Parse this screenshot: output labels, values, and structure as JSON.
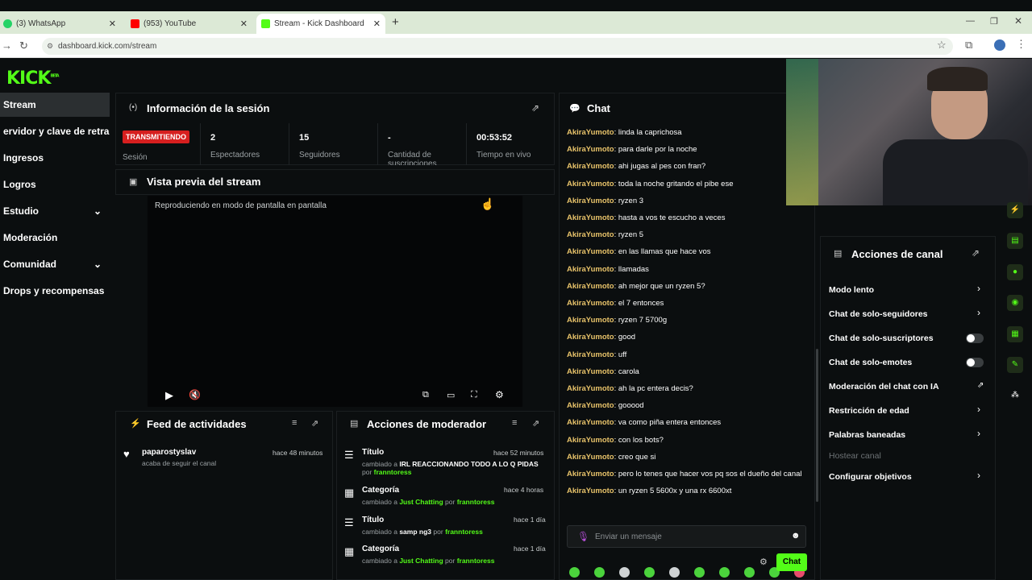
{
  "browser": {
    "tabs": [
      {
        "label": "(3) WhatsApp",
        "color": "#25d366"
      },
      {
        "label": "(953) YouTube",
        "color": "#ff0000"
      },
      {
        "label": "Stream - Kick Dashboard",
        "color": "#53fc18"
      }
    ],
    "url": "dashboard.kick.com/stream"
  },
  "app": {
    "logo": "KICK",
    "logo_sup": "BETA",
    "accent": "#53fc18"
  },
  "sidebar": {
    "items": [
      {
        "label": "Stream"
      },
      {
        "label": "ervidor y clave de retransmisión"
      },
      {
        "label": "Ingresos"
      },
      {
        "label": "Logros"
      },
      {
        "label": "Estudio"
      },
      {
        "label": "Moderación"
      },
      {
        "label": "Comunidad"
      },
      {
        "label": "Drops y recompensas"
      }
    ]
  },
  "session": {
    "title": "Información de la sesión",
    "badge": "TRANSMITIENDO",
    "badge_label": "Sesión",
    "stats": [
      {
        "value": "2",
        "label": "Espectadores"
      },
      {
        "value": "15",
        "label": "Seguidores"
      },
      {
        "value": "-",
        "label": "Cantidad de suscripciones"
      },
      {
        "value": "00:53:52",
        "label": "Tiempo en vivo"
      }
    ]
  },
  "preview": {
    "title": "Vista previa del stream",
    "message": "Reproduciendo en modo de pantalla en pantalla"
  },
  "feed": {
    "title": "Feed de actividades",
    "items": [
      {
        "user": "paparostyslav",
        "action": "acaba de seguir el canal",
        "time": "hace 48 minutos"
      }
    ]
  },
  "mod_actions": {
    "title": "Acciones de moderador",
    "items": [
      {
        "title": "Título",
        "time": "hace 52 minutos",
        "prefix": "cambiado a",
        "value": "IRL REACCIONANDO TODO A LO Q PIDAS",
        "by": "por",
        "user": "franntoress"
      },
      {
        "title": "Categoría",
        "time": "hace 4 horas",
        "prefix": "cambiado a",
        "value": "Just Chatting",
        "by": "por",
        "user": "franntoress"
      },
      {
        "title": "Título",
        "time": "hace 1 día",
        "prefix": "cambiado a",
        "value": "samp ng3",
        "by": "por",
        "user": "franntoress"
      },
      {
        "title": "Categoría",
        "time": "hace 1 día",
        "prefix": "cambiado a",
        "value": "Just Chatting",
        "by": "por",
        "user": "franntoress"
      }
    ]
  },
  "chat": {
    "title": "Chat",
    "user": "AkiraYumoto",
    "messages": [
      "linda la caprichosa",
      "para darle por la noche",
      "ahi jugas al pes con fran?",
      "toda la noche gritando el pibe ese",
      "ryzen 3",
      "hasta a vos te escucho a veces",
      "ryzen 5",
      "en las llamas que hace vos",
      "llamadas",
      "ah mejor que un ryzen 5?",
      "el 7 entonces",
      "ryzen 7 5700g",
      "good",
      "uff",
      "carola",
      "ah la pc entera decis?",
      "gooood",
      "va como piña entera entonces",
      "con los bots?",
      "creo que si",
      "pero lo tenes que hacer vos pq sos el dueño del canal",
      "un ryzen 5 5600x y una rx 6600xt"
    ],
    "input_placeholder": "Enviar un mensaje",
    "send_label": "Chat"
  },
  "channel_actions": {
    "title": "Acciones de canal",
    "items": [
      {
        "label": "Modo lento",
        "kind": "chevron"
      },
      {
        "label": "Chat de solo-seguidores",
        "kind": "chevron"
      },
      {
        "label": "Chat de solo-suscriptores",
        "kind": "toggle"
      },
      {
        "label": "Chat de solo-emotes",
        "kind": "toggle"
      },
      {
        "label": "Moderación del chat con IA",
        "kind": "external"
      },
      {
        "label": "Restricción de edad",
        "kind": "chevron"
      },
      {
        "label": "Palabras baneadas",
        "kind": "chevron"
      },
      {
        "label": "Hostear canal",
        "kind": "disabled"
      },
      {
        "label": "Configurar objetivos",
        "kind": "chevron"
      }
    ]
  }
}
